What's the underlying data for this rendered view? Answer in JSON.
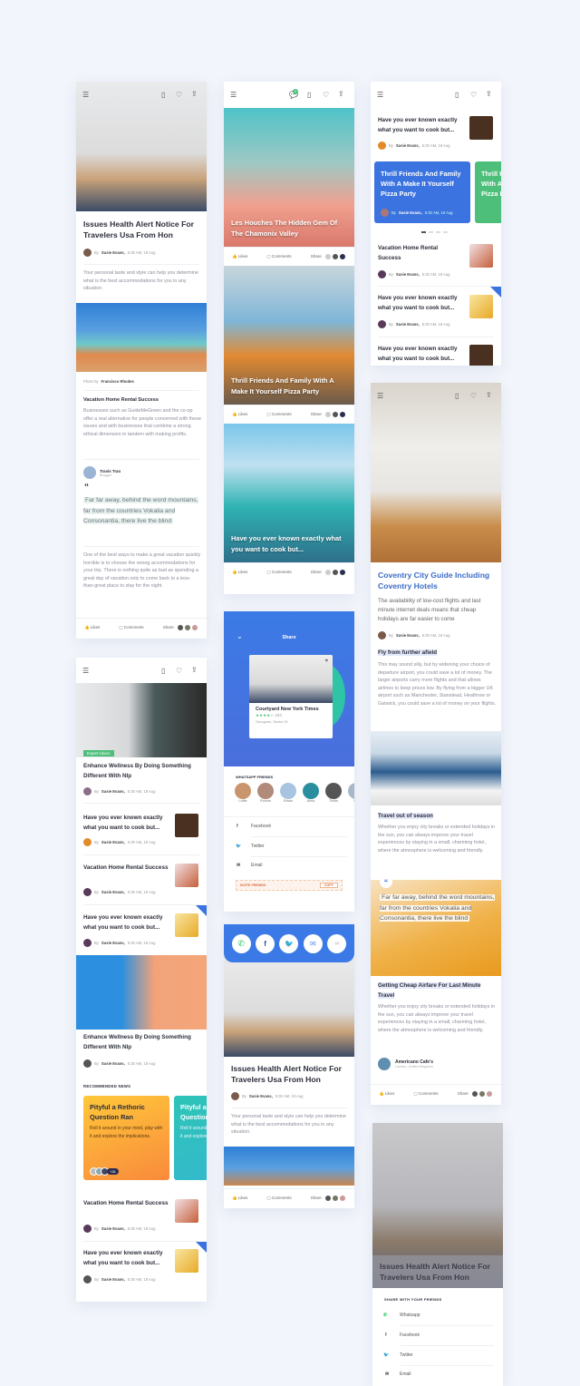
{
  "colors": {
    "background": "#f2f5fb",
    "primary_blue": "#3b73e0",
    "green": "#4dbf7a",
    "orange": "#f7a531",
    "teal": "#2ec4b6"
  },
  "common": {
    "by": "By",
    "author": "Susie Evans,",
    "time": "5:30 AM, 18 Aug",
    "likes": "Likes",
    "comments": "Comments",
    "share": "Share",
    "more_count": "+2k",
    "icons": [
      "menu-icon",
      "bookmark-icon",
      "heart-icon",
      "share-icon",
      "chat-icon"
    ]
  },
  "article": {
    "title": "Issues Health Alert Notice For Travelers Usa From Hon",
    "intro": "Your personal taste and style can help you determine what is the best accommodations for you in any situation.",
    "photo_by": "Photo by",
    "photographer": "Francisco Rhodes",
    "subtitle": "Vacation Home Rental Success",
    "paragraph": "Businesses such as GuideMeGreen and the co-op offer a real alternative for people concerned with these issues and with businesses that combine a strong ethical dimension in tandem with making profits.",
    "quote_author": "Travis Tran",
    "quote_role": "Blogger",
    "quote": "Far far away, behind the word mountains, far from the countries Vokalia and Consonantia, there live the blind",
    "closing": "One of the best ways to make a great vacation quickly horrible is to choose the wrong accommodations for your trip. There is nothing quite as bad as spending a great day of vacation only to come back to a less-than-great place to stay for the night."
  },
  "list_screen": {
    "tag": "Expert Advice",
    "headline": "Enhance Wellness By Doing Something Different With Nlp",
    "items": [
      "Have you ever known exactly what you want to cook but...",
      "Vacation Home Rental Success",
      "Have you ever known exactly what you want to cook but..."
    ],
    "headline2": "Enhance Wellness By Doing Something Different With Nlp",
    "recommended_label": "RECOMMENDED NEWS",
    "rec_cards": [
      {
        "title": "Pityful a Rethoric Question Ran",
        "text": "Roll it around in your mind, play with it and explore the implications."
      },
      {
        "title": "Pityful a Rethoric Question Ran",
        "text": "Roll it around in your mind, play with it and explore the implications."
      }
    ],
    "bottom_items": [
      "Vacation Home Rental Success",
      "Have you ever known exactly what you want to cook but..."
    ]
  },
  "feed": {
    "notification_count": "2",
    "posts": [
      "Les Houches The Hidden Gem Of The Chamonix Valley",
      "Thrill Friends And Family With A Make It Yourself Pizza Party",
      "Have you ever known exactly what you want to cook but..."
    ]
  },
  "share_sheet": {
    "title": "Share",
    "hotel_name": "Courtyard New York Times",
    "rating": 3.5,
    "reviews": "234",
    "location": "Gurugram, Sector 29",
    "friends_label": "WHATSAPP FRIENDS",
    "friends": [
      "Lottie",
      "Ronnie",
      "Edwin",
      "Alma",
      "Travis",
      "Mo"
    ],
    "options": [
      "Facebook",
      "Twitter",
      "Email"
    ],
    "invite": "INVITE FRIENDS",
    "copy": "COPY"
  },
  "share_bar": {
    "icons": [
      "whatsapp-icon",
      "facebook-icon",
      "twitter-icon",
      "email-icon",
      "link-icon"
    ]
  },
  "news_list": {
    "items": [
      "Have you ever known exactly what you want to cook but...",
      "Vacation Home Rental Success",
      "Have you ever known exactly what you want to cook but...",
      "Have you ever known exactly what you want to cook but..."
    ],
    "carousel": [
      "Thrill Friends And Family With A Make It Yourself Pizza Party",
      "Thrill Friends And Family With A Make It Yourself Pizza Party"
    ]
  },
  "guide": {
    "title": "Coventry City Guide Including Coventry Hotels",
    "intro": "The availability of low-cost flights and last minute internet deals means that cheap holidays are far easier to come",
    "h1": "Fly from further afield",
    "p1": "This may sound silly, but by widening your choice of departure airport, you could save a lot of money. The larger airports carry more flights and that allows airlines to keep prices low. By flying from a bigger UK airport such as Manchester, Stanstead, Heathrow or Gatwick, you could save a lot of money on your flights.",
    "h2": "Travel out of season",
    "p2": "Whether you enjoy city breaks or extended holidays in the sun, you can always improve your travel experiences by staying in a small, charming hotel, where the atmosphere is welcoming and friendly.",
    "quote": "Far far away, behind the word mountains, far from the countries Vokalia and Consonantia, there live the blind",
    "h3": "Getting Cheap Airfare For Last Minute Travel",
    "p3": "Whether you enjoy city breaks or extended holidays in the sun, you can always improve your travel experiences by staying in a small, charming hotel, where the atmosphere is welcoming and friendly.",
    "place": "Americano Cafe's",
    "place_loc": "London, United Kingdom"
  },
  "share_list": {
    "title": "Issues Health Alert Notice For Travelers Usa From Hon",
    "label": "SHARE WITH YOUR FRIENDS",
    "options": [
      "Whatsapp",
      "Facebook",
      "Twitter",
      "Email"
    ]
  }
}
